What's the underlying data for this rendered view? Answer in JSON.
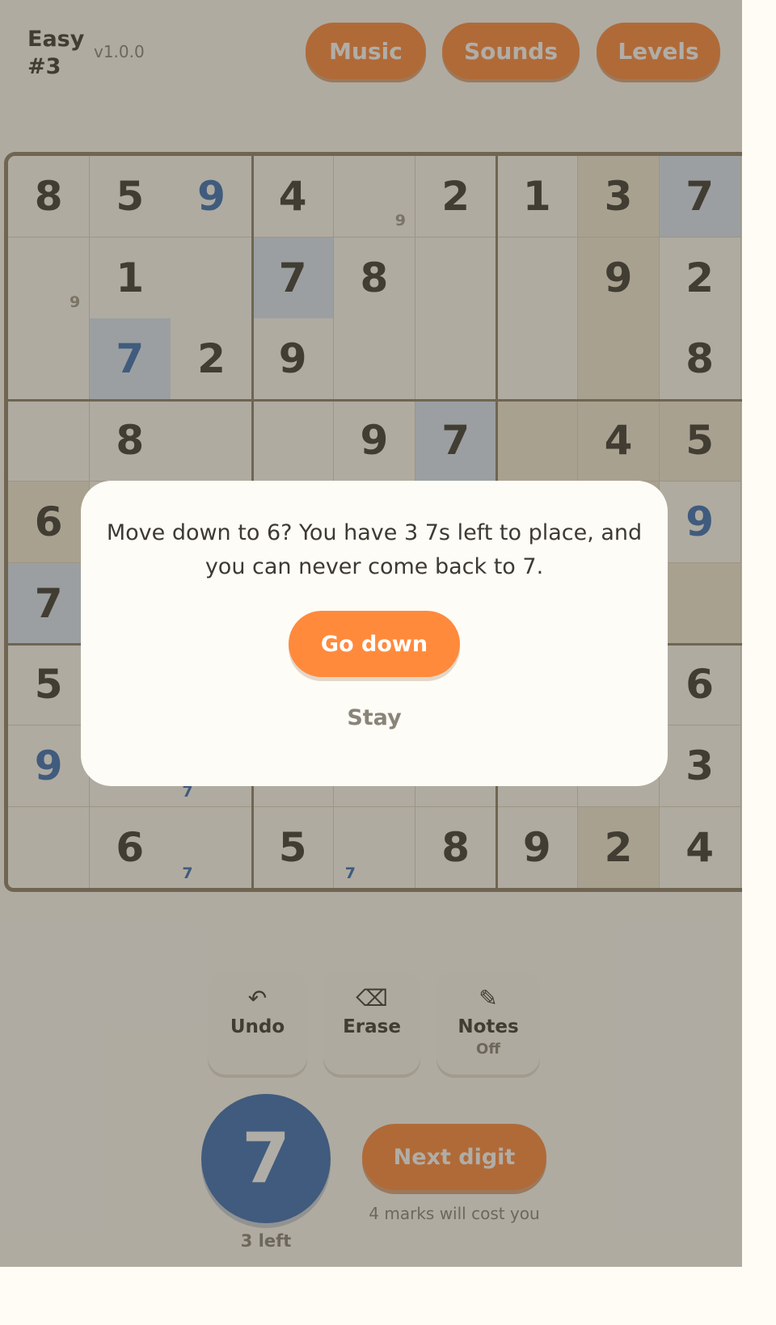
{
  "header": {
    "level_name": "Easy",
    "level_number": "#3",
    "version": "v1.0.0",
    "buttons": {
      "music": "Music",
      "sounds": "Sounds",
      "levels": "Levels"
    }
  },
  "board": {
    "cells": [
      [
        "8",
        "5",
        "9",
        "4",
        "",
        "2",
        "1",
        "3",
        "7"
      ],
      [
        "",
        "1",
        "",
        "7",
        "8",
        "",
        "",
        "9",
        "2"
      ],
      [
        "",
        "7",
        "2",
        "9",
        "",
        "",
        "",
        "",
        "8"
      ],
      [
        "",
        "8",
        "",
        "",
        "9",
        "7",
        "",
        "4",
        "5"
      ],
      [
        "6",
        "",
        "",
        "",
        "",
        "",
        "",
        "",
        "9"
      ],
      [
        "7",
        "",
        "",
        "",
        "",
        "",
        "",
        "",
        ""
      ],
      [
        "5",
        "",
        "",
        "",
        "",
        "",
        "",
        "",
        "6"
      ],
      [
        "9",
        "",
        "",
        "",
        "",
        "",
        "",
        "",
        "3"
      ],
      [
        "",
        "6",
        "",
        "5",
        "",
        "8",
        "9",
        "2",
        "4"
      ]
    ],
    "user_entered": [
      [
        0,
        2
      ],
      [
        2,
        1
      ],
      [
        4,
        8
      ],
      [
        7,
        0
      ]
    ],
    "digit_highlight": [
      [
        0,
        8
      ],
      [
        1,
        3
      ],
      [
        2,
        1
      ],
      [
        3,
        5
      ],
      [
        5,
        0
      ]
    ],
    "zone_highlight": [
      [
        0,
        7
      ],
      [
        1,
        7
      ],
      [
        2,
        7
      ],
      [
        3,
        6
      ],
      [
        3,
        7
      ],
      [
        3,
        8
      ],
      [
        4,
        0
      ],
      [
        4,
        6
      ],
      [
        4,
        7
      ],
      [
        5,
        6
      ],
      [
        5,
        7
      ],
      [
        5,
        8
      ],
      [
        8,
        7
      ]
    ],
    "notes": [
      {
        "row": 0,
        "col": 4,
        "text": "9"
      },
      {
        "row": 1,
        "col": 0,
        "text": "9"
      },
      {
        "row": 7,
        "col": 2,
        "text": "7"
      },
      {
        "row": 8,
        "col": 2,
        "text": "7"
      },
      {
        "row": 8,
        "col": 4,
        "text": "7"
      }
    ],
    "colors": {
      "given": "#3d3a33",
      "user": "#3a6fb5",
      "note": "#a39b8e",
      "digit_highlight": "#dbe7f4",
      "zone_highlight": "#f3ead6"
    }
  },
  "tools": {
    "undo": {
      "icon": "undo-arrow-icon",
      "label": "Undo"
    },
    "erase": {
      "icon": "backspace-icon",
      "label": "Erase"
    },
    "notes": {
      "icon": "pencil-icon",
      "label": "Notes",
      "state": "Off"
    }
  },
  "current_digit": {
    "value": "7",
    "remaining": "3 left"
  },
  "next_digit": {
    "label": "Next digit",
    "note": "4 marks will cost you"
  },
  "modal": {
    "message": "Move down to 6? You have 3 7s left to place, and you can never come back to 7.",
    "confirm": "Go down",
    "cancel": "Stay"
  },
  "palette": {
    "accent": "#ff8a3c",
    "blue": "#3a6fb5",
    "text": "#3d3a33",
    "muted": "#8a8478",
    "grid_line": "#8e806a"
  }
}
